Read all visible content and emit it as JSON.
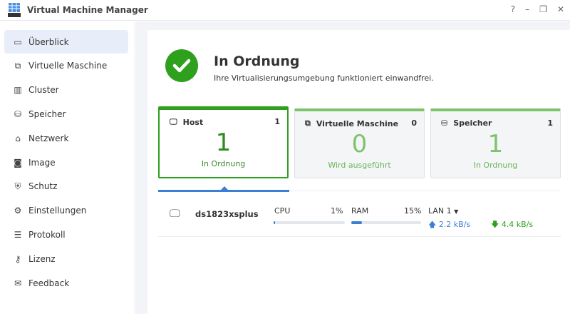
{
  "app": {
    "title": "Virtual Machine Manager",
    "help": "?",
    "minimize": "–",
    "restore": "❐",
    "close": "✕"
  },
  "sidebar": {
    "items": [
      {
        "label": "Überblick",
        "icon": "overview-icon",
        "glyph": "▭"
      },
      {
        "label": "Virtuelle Maschine",
        "icon": "vm-icon",
        "glyph": "⧉"
      },
      {
        "label": "Cluster",
        "icon": "cluster-icon",
        "glyph": "▥"
      },
      {
        "label": "Speicher",
        "icon": "storage-icon",
        "glyph": "⛁"
      },
      {
        "label": "Netzwerk",
        "icon": "network-icon",
        "glyph": "⌂"
      },
      {
        "label": "Image",
        "icon": "image-icon",
        "glyph": "◙"
      },
      {
        "label": "Schutz",
        "icon": "shield-icon",
        "glyph": "⛨"
      },
      {
        "label": "Einstellungen",
        "icon": "gear-icon",
        "glyph": "⚙"
      },
      {
        "label": "Protokoll",
        "icon": "list-icon",
        "glyph": "☰"
      },
      {
        "label": "Lizenz",
        "icon": "key-icon",
        "glyph": "⚷"
      },
      {
        "label": "Feedback",
        "icon": "mail-icon",
        "glyph": "✉"
      }
    ]
  },
  "status": {
    "title": "In Ordnung",
    "subtitle": "Ihre Virtualisierungsumgebung funktioniert einwandfrei."
  },
  "cards": [
    {
      "title": "Host",
      "count": "1",
      "value": "1",
      "label": "In Ordnung",
      "glyph": "🖵"
    },
    {
      "title": "Virtuelle Maschine",
      "count": "0",
      "value": "0",
      "label": "Wird ausgeführt",
      "glyph": "⧉"
    },
    {
      "title": "Speicher",
      "count": "1",
      "value": "1",
      "label": "In Ordnung",
      "glyph": "⛁"
    }
  ],
  "host": {
    "name": "ds1823xsplus",
    "cpu_label": "CPU",
    "cpu": "1%",
    "cpu_fraction": 0.01,
    "ram_label": "RAM",
    "ram": "15%",
    "ram_fraction": 0.15,
    "lan": "LAN 1",
    "up": "2.2 kB/s",
    "down": "4.4 kB/s"
  },
  "colors": {
    "accent": "#3b7fd4",
    "ok": "#2ea01d",
    "ok_light": "#7cc36a"
  }
}
